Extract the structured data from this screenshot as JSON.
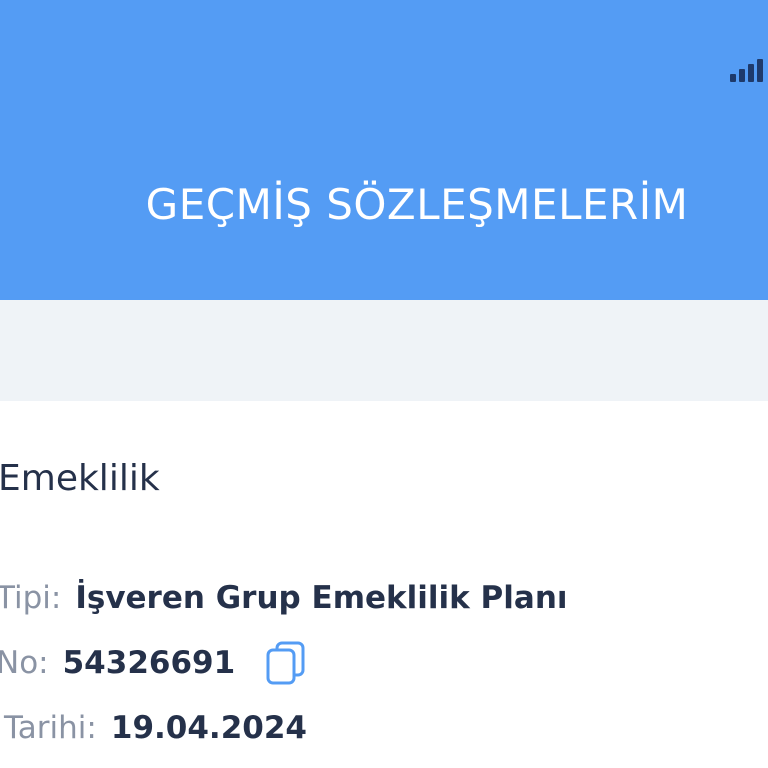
{
  "header": {
    "title": "GEÇMİŞ SÖZLEŞMELERİM",
    "background": "#549cf4",
    "status_icon": "signal-strength-icon"
  },
  "band": {
    "color": "#eff3f7"
  },
  "contract": {
    "section_title": "Emeklilik",
    "type_label": "Tipi:",
    "type_value": "İşveren Grup Emeklilik Planı",
    "no_label": "No:",
    "no_value": "54326691",
    "copy_icon": "copy-icon",
    "date_label": "Tarihi:",
    "date_value": "19.04.2024"
  },
  "colors": {
    "text_dark": "#25314a",
    "text_muted": "#8a93a4",
    "copy_icon": "#549cf4"
  }
}
